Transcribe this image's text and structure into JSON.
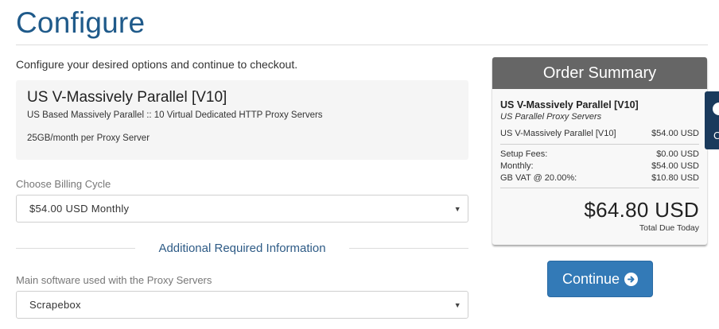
{
  "page": {
    "title": "Configure",
    "intro": "Configure your desired options and continue to checkout."
  },
  "product": {
    "name": "US V-Massively Parallel [V10]",
    "description": "US Based Massively Parallel :: 10 Virtual Dedicated HTTP Proxy Servers",
    "extra": "25GB/month per Proxy Server"
  },
  "billing": {
    "label": "Choose Billing Cycle",
    "selected": "$54.00 USD Monthly"
  },
  "additional": {
    "heading": "Additional Required Information",
    "software_label": "Main software used with the Proxy Servers",
    "software_selected": "Scrapebox"
  },
  "summary": {
    "header": "Order Summary",
    "product_name": "US V-Massively Parallel [V10]",
    "product_group": "US Parallel Proxy Servers",
    "line_item": {
      "label": "US V-Massively Parallel [V10]",
      "amount": "$54.00 USD"
    },
    "fees": [
      {
        "label": "Setup Fees:",
        "amount": "$0.00 USD"
      },
      {
        "label": "Monthly:",
        "amount": "$54.00 USD"
      },
      {
        "label": "GB VAT @ 20.00%:",
        "amount": "$10.80 USD"
      }
    ],
    "total": "$64.80 USD",
    "total_label": "Total Due Today"
  },
  "actions": {
    "continue_label": "Continue"
  },
  "side_tab": {
    "letter": "C"
  },
  "colors": {
    "title_blue": "#1f5a8a",
    "button_blue": "#337ab7",
    "summary_header": "#666666",
    "side_tab": "#1a3a5c"
  },
  "icons": {
    "continue": "arrow-circle-right-icon",
    "select_caret": "caret-down-icon",
    "side_tab": "chat-icon"
  }
}
